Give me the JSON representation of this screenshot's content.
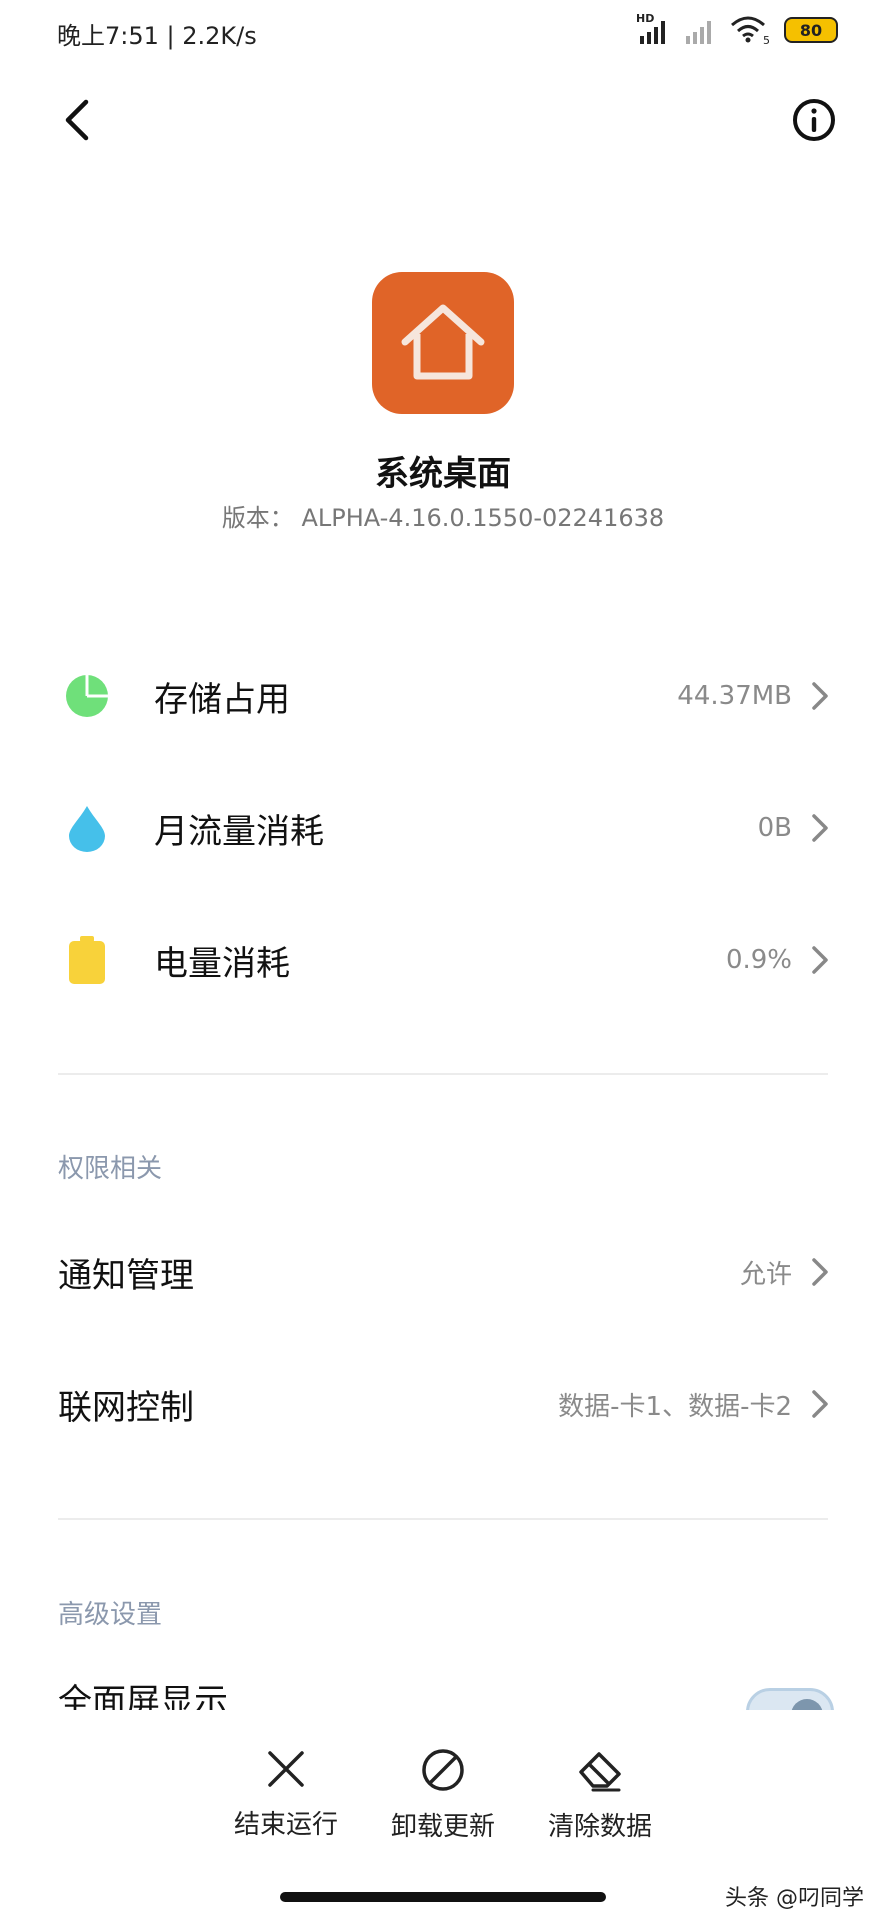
{
  "status_bar": {
    "time_speed": "晚上7:51 | 2.2K/s",
    "hd_label": "HD",
    "wifi_label": "5",
    "battery": "80"
  },
  "app": {
    "name": "系统桌面",
    "version": "版本： ALPHA-4.16.0.1550-02241638",
    "icon_color": "#e06428"
  },
  "usage": [
    {
      "label": "存储占用",
      "value": "44.37MB",
      "icon": "pie-chart-icon",
      "color": "#6fe07a"
    },
    {
      "label": "月流量消耗",
      "value": "0B",
      "icon": "water-drop-icon",
      "color": "#45c0ea"
    },
    {
      "label": "电量消耗",
      "value": "0.9%",
      "icon": "battery-icon",
      "color": "#f8d23a"
    }
  ],
  "permissions": {
    "title": "权限相关",
    "items": [
      {
        "label": "通知管理",
        "value": "允许"
      },
      {
        "label": "联网控制",
        "value": "数据-卡1、数据-卡2"
      }
    ]
  },
  "advanced": {
    "title": "高级设置",
    "items": [
      {
        "label": "全面屏显示",
        "toggle": true
      }
    ]
  },
  "actions": [
    {
      "label": "结束运行",
      "icon": "close-icon"
    },
    {
      "label": "卸载更新",
      "icon": "prohibit-icon"
    },
    {
      "label": "清除数据",
      "icon": "eraser-icon"
    }
  ],
  "watermark": "头条 @叼同学"
}
